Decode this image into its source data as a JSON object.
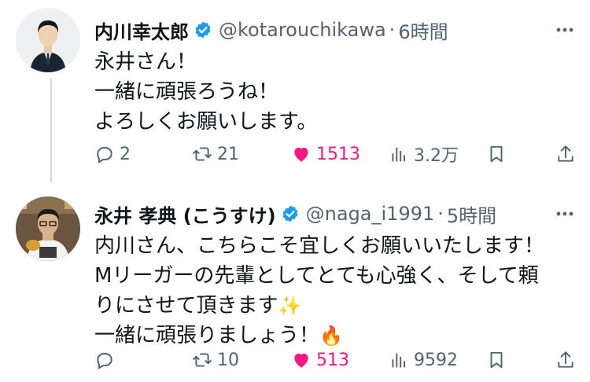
{
  "tweets": [
    {
      "name": "内川幸太郎",
      "handle": "@kotarouchikawa",
      "sep": "·",
      "time": "6時間",
      "lines": [
        "永井さん！",
        "一緒に頑張ろうね！",
        "よろしくお願いします。"
      ],
      "replies": "2",
      "retweets": "21",
      "likes": "1513",
      "views": "3.2万"
    },
    {
      "name": "永井 孝典 (こうすけ)",
      "handle": "@naga_i1991",
      "sep": "·",
      "time": "5時間",
      "lines": [
        "内川さん、こちらこそ宜しくお願いいたします！",
        "Mリーガーの先輩としてとても心強く、そして頼",
        "りにさせて頂きます",
        "一緒に頑張りましょう！"
      ],
      "emoji_sparkles": "✨",
      "emoji_fire": "🔥",
      "replies": "",
      "retweets": "10",
      "likes": "513",
      "views": "9592"
    }
  ],
  "icons": [
    "reply-icon",
    "retweet-icon",
    "like-icon",
    "views-icon",
    "bookmark-icon",
    "share-icon",
    "more-icon",
    "verified-icon"
  ],
  "colors": {
    "like": "#f91880",
    "verified": "#1d9bf0",
    "secondary": "#536471",
    "thread_line": "#cfd9de"
  }
}
